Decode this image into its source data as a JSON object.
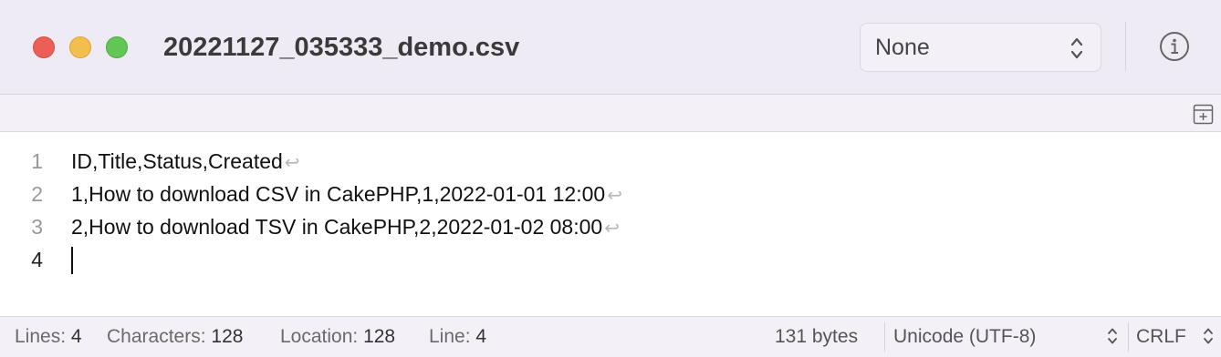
{
  "window": {
    "title": "20221127_035333_demo.csv",
    "mode_select_value": "None"
  },
  "icons": {
    "info": "info-circle-icon",
    "split": "split-editor-icon",
    "eol": "return-arrow-icon"
  },
  "colors": {
    "close": "#ec5f57",
    "minimize": "#f4be4f",
    "zoom": "#62c555"
  },
  "editor": {
    "lines": [
      {
        "number": "1",
        "text": "ID,Title,Status,Created",
        "eol": "↩"
      },
      {
        "number": "2",
        "text": "1,How to download CSV in CakePHP,1,2022-01-01 12:00",
        "eol": "↩"
      },
      {
        "number": "3",
        "text": "2,How to download TSV in CakePHP,2,2022-01-02 08:00",
        "eol": "↩"
      },
      {
        "number": "4",
        "text": "",
        "eol": ""
      }
    ]
  },
  "status": {
    "lines_label": "Lines:",
    "lines_value": "4",
    "chars_label": "Characters:",
    "chars_value": "128",
    "location_label": "Location:",
    "location_value": "128",
    "line_label": "Line:",
    "line_value": "4",
    "bytes": "131 bytes",
    "encoding": "Unicode (UTF-8)",
    "line_ending": "CRLF"
  }
}
